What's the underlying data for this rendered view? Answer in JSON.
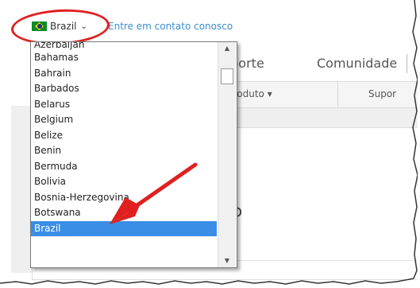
{
  "header": {
    "country": "Brazil",
    "contact_link": "Entre em contato conosco"
  },
  "nav": {
    "items": [
      "uporte",
      "Comunidade"
    ]
  },
  "subnav": {
    "items": [
      "produto",
      "Supor"
    ]
  },
  "main": {
    "heading_fragment": "to"
  },
  "dropdown": {
    "items": [
      "Azerbaijan",
      "Bahamas",
      "Bahrain",
      "Barbados",
      "Belarus",
      "Belgium",
      "Belize",
      "Benin",
      "Bermuda",
      "Bolivia",
      "Bosnia-Herzegovina",
      "Botswana",
      "Brazil"
    ],
    "selected": "Brazil"
  },
  "colors": {
    "link": "#3a8fce",
    "selection": "#3a8ee6",
    "annotation": "#e02020",
    "flag_green": "#0b8a2a",
    "flag_yellow": "#f7d500",
    "flag_blue": "#1c2f8c"
  },
  "icons": {
    "flag": "brazil-flag-icon",
    "chevron": "chevron-down-icon",
    "scroll_up": "triangle-up-icon",
    "scroll_down": "triangle-down-icon",
    "arrow": "red-annotation-arrow-icon"
  }
}
